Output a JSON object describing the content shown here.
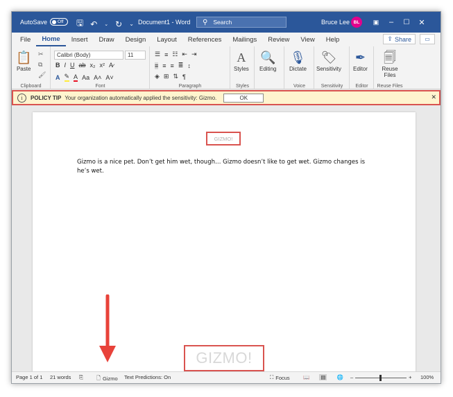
{
  "titlebar": {
    "autosave_label": "AutoSave",
    "autosave_state": "Off",
    "doc_title": "Document1 - Word",
    "search_placeholder": "Search",
    "user_name": "Bruce Lee",
    "user_initials": "BL"
  },
  "ribbon_tabs": [
    "File",
    "Home",
    "Insert",
    "Draw",
    "Design",
    "Layout",
    "References",
    "Mailings",
    "Review",
    "View",
    "Help"
  ],
  "share_label": "Share",
  "ribbon": {
    "paste_label": "Paste",
    "font_name": "Calibri (Body)",
    "font_size": "11",
    "groups": {
      "clipboard": "Clipboard",
      "font": "Font",
      "paragraph": "Paragraph",
      "styles": "Styles",
      "voice": "Voice",
      "sensitivity": "Sensitivity",
      "editor": "Editor",
      "reuse_files": "Reuse Files"
    },
    "buttons": {
      "styles": "Styles",
      "editing": "Editing",
      "dictate": "Dictate",
      "sensitivity": "Sensitivity",
      "editor": "Editor",
      "reuse_files": "Reuse Files"
    }
  },
  "policy_bar": {
    "title": "POLICY TIP",
    "message": "Your organization automatically applied the sensitivity: Gizmo.",
    "ok_label": "OK"
  },
  "document": {
    "header_label": "GIZMO!",
    "body": "Gizmo is a nice pet.  Don’t get him wet, though… Gizmo doesn’t like to get wet.  Gizmo changes is he’s wet.",
    "watermark": "GIZMO!"
  },
  "statusbar": {
    "page": "Page 1 of 1",
    "words": "21 words",
    "sensitivity": "Gizmo",
    "text_predictions": "Text Predictions: On",
    "focus": "Focus",
    "zoom": "100%"
  },
  "colors": {
    "titlebar": "#2b579a",
    "avatar": "#e3008c",
    "policy_bg": "#fff4ce",
    "highlight_box": "#d9534f",
    "arrow": "#e8423a"
  }
}
